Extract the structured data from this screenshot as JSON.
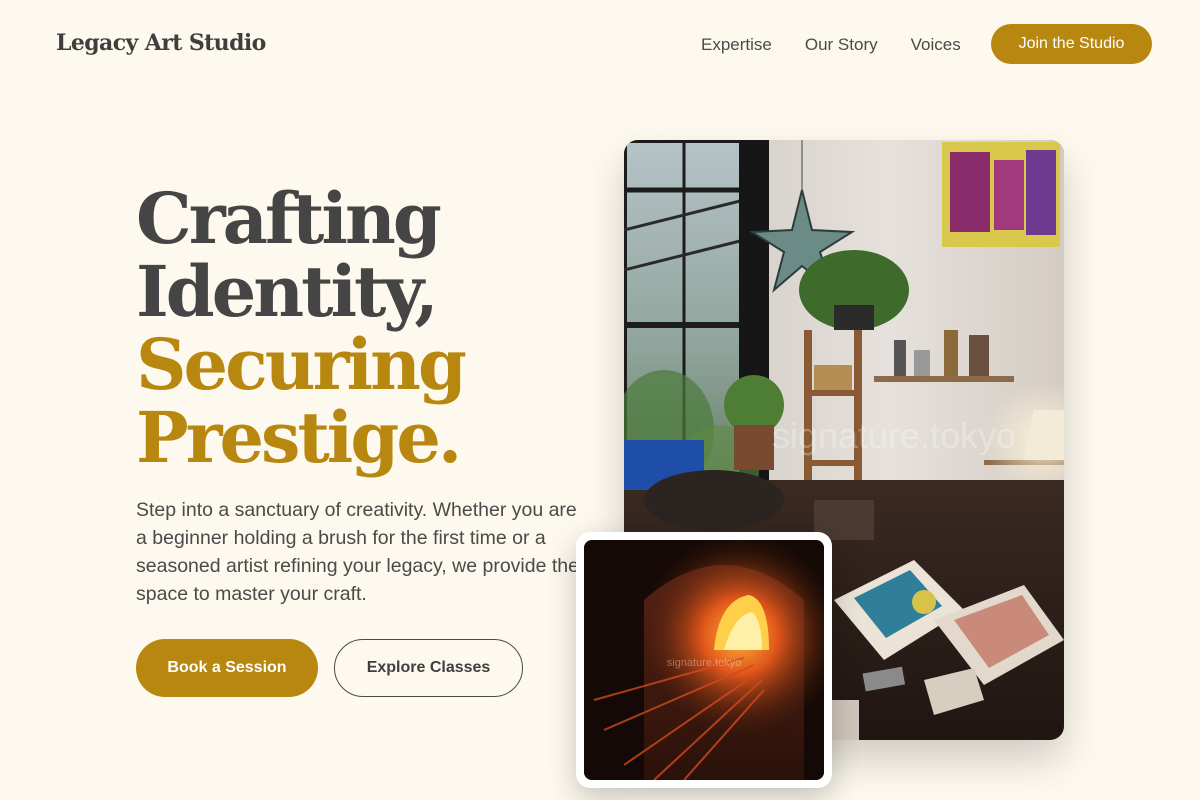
{
  "header": {
    "logo": "Legacy Art Studio",
    "nav": [
      {
        "label": "Expertise"
      },
      {
        "label": "Our Story"
      },
      {
        "label": "Voices"
      }
    ],
    "cta_label": "Join the Studio"
  },
  "hero": {
    "title_line1": "Crafting",
    "title_line2": "Identity,",
    "title_line3": "Securing",
    "title_line4": "Prestige.",
    "description": "Step into a sanctuary of creativity. Whether you are a beginner holding a brush for the first time or a seasoned artist refining your legacy, we provide the space to master your craft.",
    "primary_button": "Book a Session",
    "secondary_button": "Explore Classes"
  },
  "images": {
    "studio_watermark": "signature.tokyo",
    "forge_watermark": "signature.tokyo"
  },
  "colors": {
    "background": "#fdf9ee",
    "accent": "#b8870f",
    "text": "#454545"
  }
}
